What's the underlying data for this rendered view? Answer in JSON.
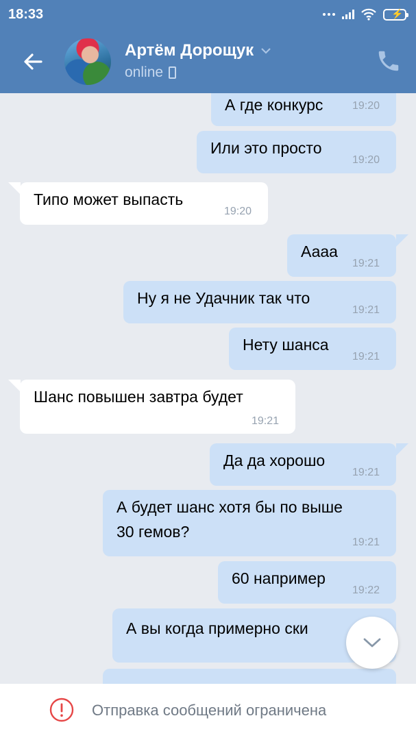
{
  "status_bar": {
    "time": "18:33"
  },
  "header": {
    "contact_name": "Артём Дорощук",
    "presence": "online"
  },
  "messages": [
    {
      "dir": "out",
      "text": "А где конкурс",
      "time": "19:20"
    },
    {
      "dir": "out",
      "text": "Или это просто",
      "time": "19:20"
    },
    {
      "dir": "in",
      "text": "Типо может выпасть",
      "time": "19:20"
    },
    {
      "dir": "out",
      "text": "Аааа",
      "time": "19:21"
    },
    {
      "dir": "out",
      "text": "Ну я не Удачник так что",
      "time": "19:21"
    },
    {
      "dir": "out",
      "text": "Нету шанса",
      "time": "19:21"
    },
    {
      "dir": "in",
      "text": "Шанс повышен завтра будет",
      "time": "19:21"
    },
    {
      "dir": "out",
      "text": "Да да хорошо",
      "time": "19:21"
    },
    {
      "dir": "out",
      "text_line1": "А будет шанс хотя бы по выше",
      "text_line2": "30 гемов?",
      "time": "19:21"
    },
    {
      "dir": "out",
      "text": "60 например",
      "time": "19:22"
    },
    {
      "dir": "out",
      "text": "А вы когда примерно ски"
    },
    {
      "dir": "out",
      "text": ""
    }
  ],
  "footer": {
    "restriction_text": "Отправка сообщений ограничена"
  },
  "colors": {
    "header": "#5181b8",
    "outgoing_bubble": "#cce0f7",
    "incoming_bubble": "#ffffff",
    "background": "#e8ebf0",
    "warning": "#e64646"
  },
  "icons": [
    "back-arrow-icon",
    "chevron-down-icon",
    "mobile-icon",
    "phone-icon",
    "scroll-down-icon",
    "warning-icon"
  ]
}
